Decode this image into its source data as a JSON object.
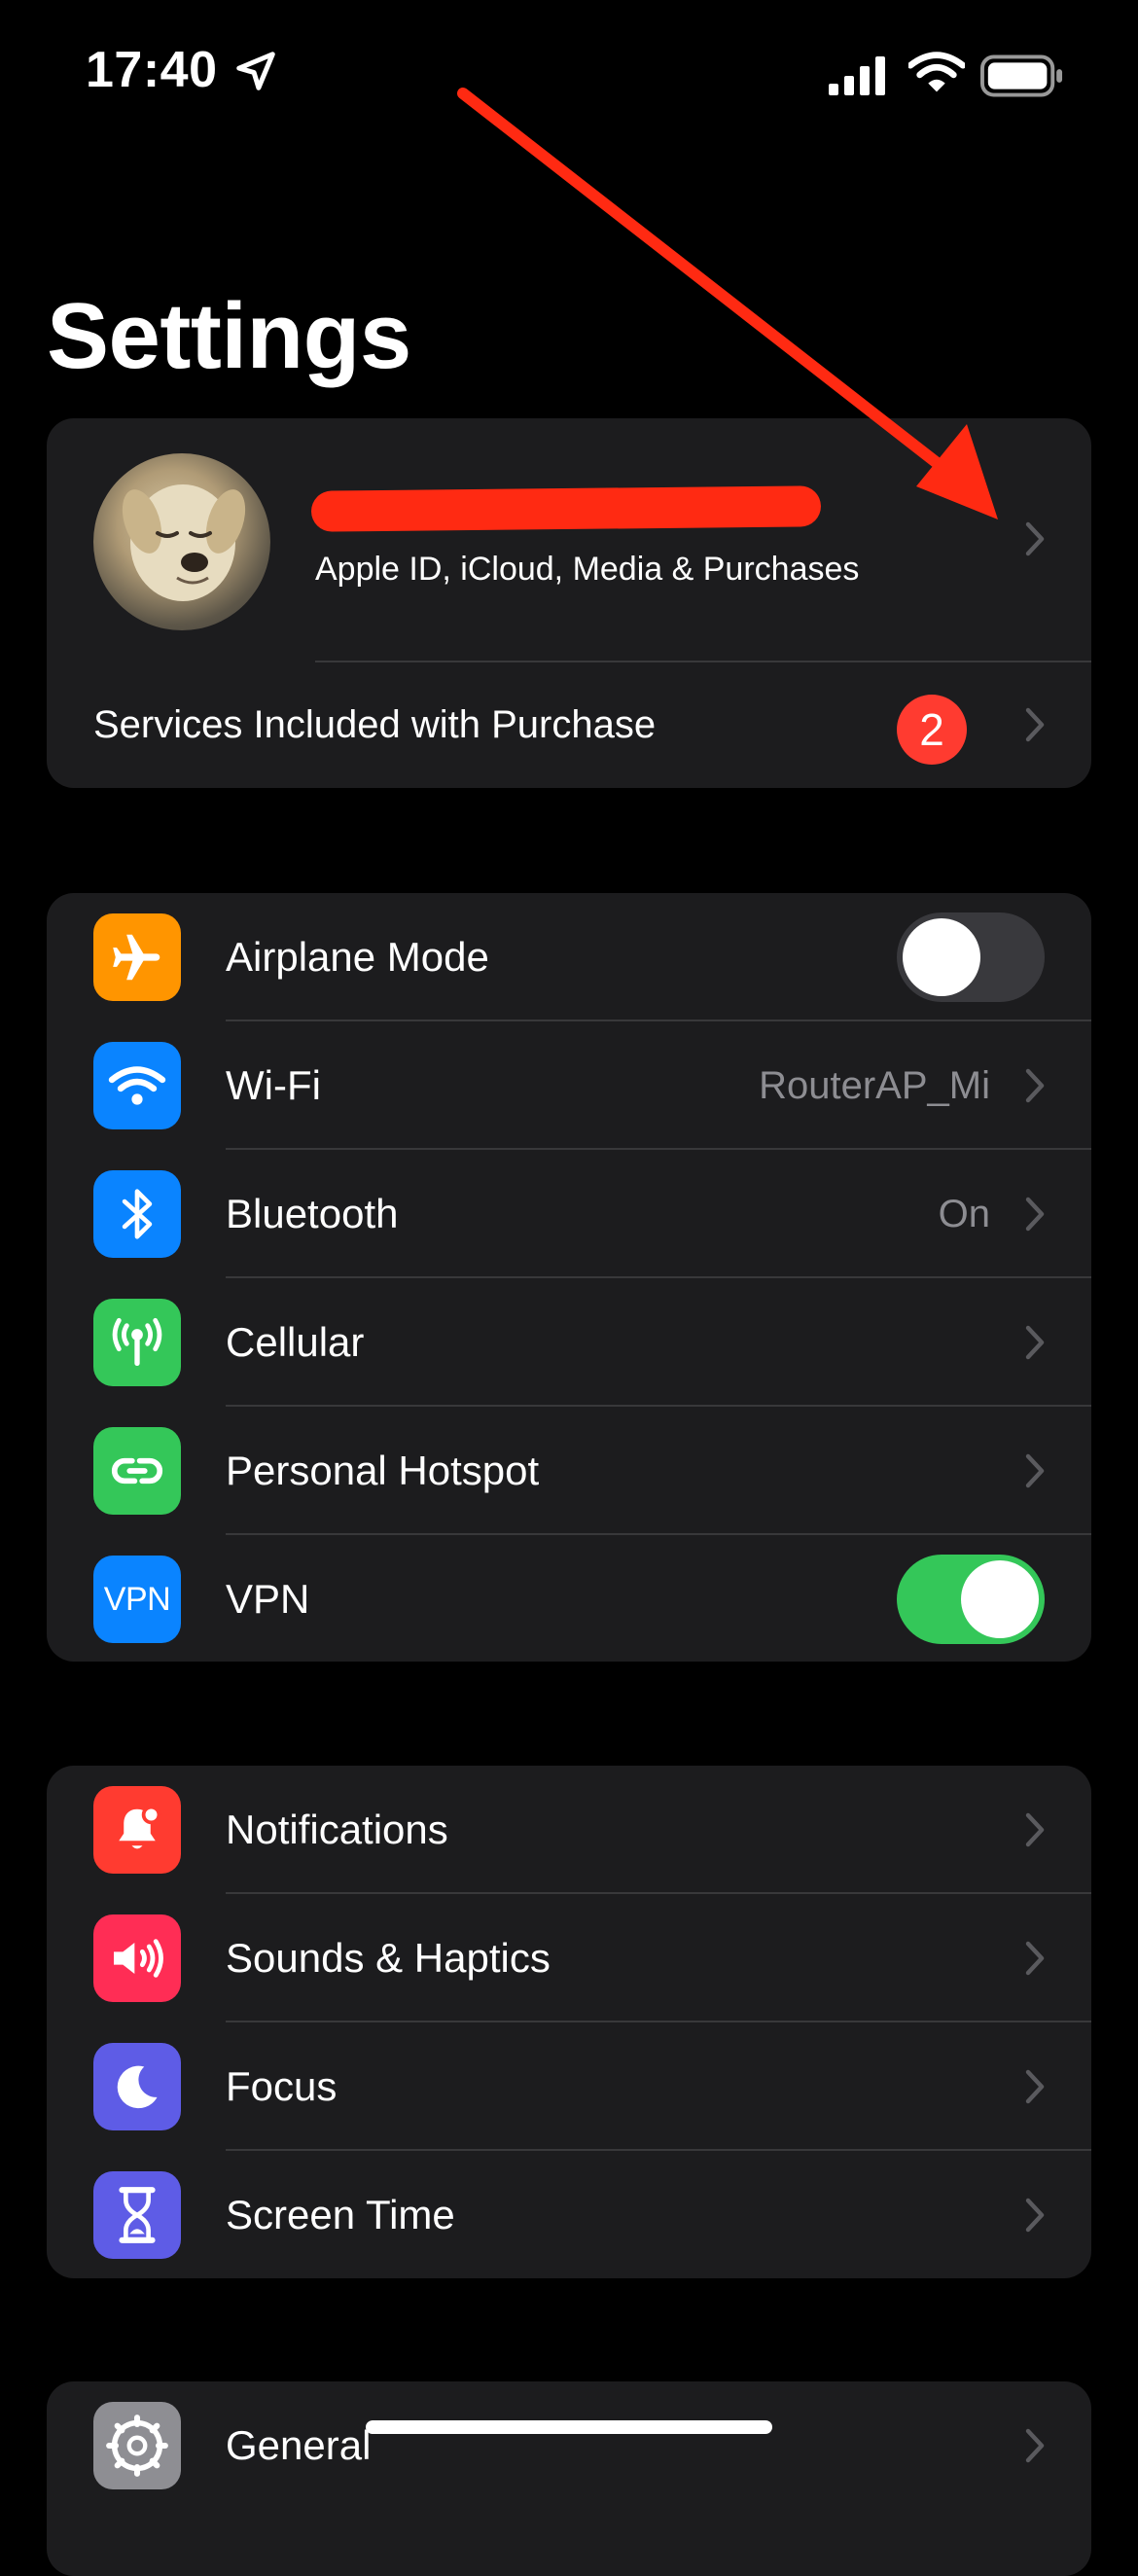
{
  "status_bar": {
    "time": "17:40",
    "location_icon": "location-arrow-icon",
    "signal_icon": "cellular-signal-icon",
    "wifi_icon": "wifi-icon",
    "battery_icon": "battery-icon"
  },
  "page": {
    "title": "Settings"
  },
  "account": {
    "subtitle": "Apple ID, iCloud, Media & Purchases",
    "avatar_icon": "avatar-photo",
    "services_label": "Services Included with Purchase",
    "services_badge": "2"
  },
  "connectivity": {
    "items": [
      {
        "label": "Airplane Mode",
        "icon": "airplane-icon",
        "color": "#ff9500",
        "toggle": false
      },
      {
        "label": "Wi-Fi",
        "icon": "wifi-icon",
        "color": "#0a84ff",
        "value": "RouterAP_Mi"
      },
      {
        "label": "Bluetooth",
        "icon": "bluetooth-icon",
        "color": "#0a84ff",
        "value": "On"
      },
      {
        "label": "Cellular",
        "icon": "antenna-icon",
        "color": "#34c759"
      },
      {
        "label": "Personal Hotspot",
        "icon": "hotspot-link-icon",
        "color": "#34c759"
      },
      {
        "label": "VPN",
        "icon": "vpn-icon",
        "icon_text": "VPN",
        "color": "#0a84ff",
        "toggle": true
      }
    ]
  },
  "notifications_group": {
    "items": [
      {
        "label": "Notifications",
        "icon": "bell-badge-icon",
        "color": "#ff3b30"
      },
      {
        "label": "Sounds & Haptics",
        "icon": "speaker-icon",
        "color": "#ff2d55"
      },
      {
        "label": "Focus",
        "icon": "moon-icon",
        "color": "#5e5ce6"
      },
      {
        "label": "Screen Time",
        "icon": "hourglass-icon",
        "color": "#5e5ce6"
      }
    ]
  },
  "general_group": {
    "items": [
      {
        "label": "General",
        "icon": "gear-icon",
        "color": "#8e8e93"
      }
    ]
  },
  "colors": {
    "background": "#000000",
    "group_background": "#1c1c1e",
    "separator": "#38383a",
    "secondary_text": "#8d8d92",
    "annotation": "#ff2a12",
    "toggle_on": "#34c759"
  }
}
